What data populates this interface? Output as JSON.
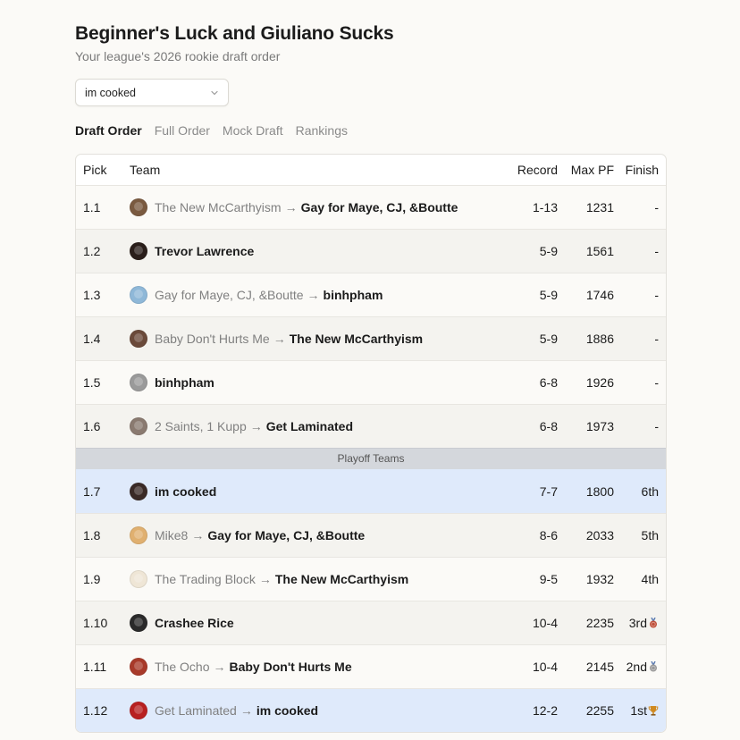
{
  "league": {
    "title": "Beginner's Luck and Giuliano Sucks",
    "subtitle": "Your league's 2026 rookie draft order"
  },
  "team_select": {
    "value": "im cooked"
  },
  "tabs": [
    {
      "label": "Draft Order",
      "active": true
    },
    {
      "label": "Full Order",
      "active": false
    },
    {
      "label": "Mock Draft",
      "active": false
    },
    {
      "label": "Rankings",
      "active": false
    }
  ],
  "table": {
    "headers": {
      "pick": "Pick",
      "team": "Team",
      "record": "Record",
      "maxpf": "Max PF",
      "finish": "Finish"
    },
    "divider_label": "Playoff Teams",
    "arrow": "→",
    "rows": [
      {
        "pick": "1.1",
        "from": "The New McCarthyism",
        "owner": "Gay for Maye, CJ, &Boutte",
        "record": "1-13",
        "maxpf": "1231",
        "finish": "-",
        "avatar_color": "#7a5a40"
      },
      {
        "pick": "1.2",
        "from": "",
        "owner": "Trevor Lawrence",
        "record": "5-9",
        "maxpf": "1561",
        "finish": "-",
        "avatar_color": "#2a1e1a"
      },
      {
        "pick": "1.3",
        "from": "Gay for Maye, CJ, &Boutte",
        "owner": "binhpham",
        "record": "5-9",
        "maxpf": "1746",
        "finish": "-",
        "avatar_color": "#8fb8d8"
      },
      {
        "pick": "1.4",
        "from": "Baby Don't Hurts Me",
        "owner": "The New McCarthyism",
        "record": "5-9",
        "maxpf": "1886",
        "finish": "-",
        "avatar_color": "#6b4a3a"
      },
      {
        "pick": "1.5",
        "from": "",
        "owner": "binhpham",
        "record": "6-8",
        "maxpf": "1926",
        "finish": "-",
        "avatar_color": "#9a9a9a"
      },
      {
        "pick": "1.6",
        "from": "2 Saints, 1 Kupp",
        "owner": "Get Laminated",
        "record": "6-8",
        "maxpf": "1973",
        "finish": "-",
        "avatar_color": "#8a7a70"
      },
      {
        "pick": "1.7",
        "from": "",
        "owner": "im cooked",
        "record": "7-7",
        "maxpf": "1800",
        "finish": "6th",
        "avatar_color": "#3a2a26"
      },
      {
        "pick": "1.8",
        "from": "Mike8",
        "owner": "Gay for Maye, CJ, &Boutte",
        "record": "8-6",
        "maxpf": "2033",
        "finish": "5th",
        "avatar_color": "#e0b070"
      },
      {
        "pick": "1.9",
        "from": "The Trading Block",
        "owner": "The New McCarthyism",
        "record": "9-5",
        "maxpf": "1932",
        "finish": "4th",
        "avatar_color": "#efe6d6"
      },
      {
        "pick": "1.10",
        "from": "",
        "owner": "Crashee Rice",
        "record": "10-4",
        "maxpf": "2235",
        "finish": "3rd",
        "avatar_color": "#2a2a2a",
        "medal": "bronze"
      },
      {
        "pick": "1.11",
        "from": "The Ocho",
        "owner": "Baby Don't Hurts Me",
        "record": "10-4",
        "maxpf": "2145",
        "finish": "2nd",
        "avatar_color": "#a83a2a",
        "medal": "silver"
      },
      {
        "pick": "1.12",
        "from": "Get Laminated",
        "owner": "im cooked",
        "record": "12-2",
        "maxpf": "2255",
        "finish": "1st",
        "avatar_color": "#b82020",
        "medal": "trophy"
      }
    ]
  },
  "colors": {
    "highlight_row": "#dfeafb",
    "divider": "#d4d7dc",
    "bronze": "#c0503a",
    "silver": "#9a9a9a",
    "trophy": "#d08a20"
  }
}
